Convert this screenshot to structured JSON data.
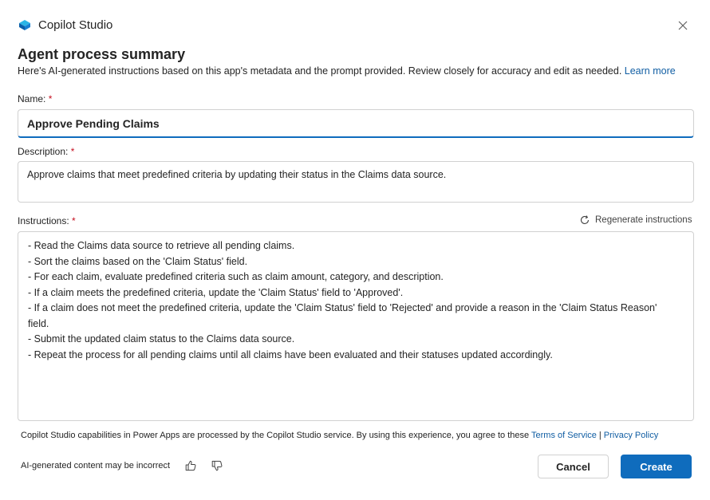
{
  "app": {
    "name": "Copilot Studio"
  },
  "dialog": {
    "title": "Agent process summary",
    "subtitle": "Here's AI-generated instructions based on this app's metadata and the prompt provided. Review closely for accuracy and edit as needed.",
    "learn_more": "Learn more"
  },
  "fields": {
    "name": {
      "label": "Name:",
      "required": "*",
      "value": "Approve Pending Claims"
    },
    "description": {
      "label": "Description:",
      "required": "*",
      "value": "Approve claims that meet predefined criteria by updating their status in the Claims data source."
    },
    "instructions": {
      "label": "Instructions:",
      "required": "*",
      "regenerate_label": "Regenerate instructions",
      "lines": [
        "- Read the Claims data source to retrieve all pending claims.",
        "- Sort the claims based on the 'Claim Status' field.",
        "- For each claim, evaluate predefined criteria such as claim amount, category, and description.",
        "- If a claim meets the predefined criteria, update the 'Claim Status' field to 'Approved'.",
        "- If a claim does not meet the predefined criteria, update the 'Claim Status' field to 'Rejected' and provide a reason in the 'Claim Status Reason'",
        "field.",
        "- Submit the updated claim status to the Claims data source.",
        "- Repeat the process for all pending claims until all claims have been evaluated and their statuses updated accordingly."
      ]
    }
  },
  "footer": {
    "disclaimer": "Copilot Studio capabilities in Power Apps are processed by the Copilot Studio service. By using this experience, you agree to these",
    "terms_link": "Terms of Service",
    "separator": "|",
    "privacy_link": "Privacy Policy",
    "ai_note": "AI-generated content may be incorrect",
    "cancel_label": "Cancel",
    "create_label": "Create"
  },
  "icons": {
    "logo": "copilot-studio-logo",
    "close": "close-icon",
    "regenerate": "refresh-icon",
    "thumbs_up": "thumbs-up-icon",
    "thumbs_down": "thumbs-down-icon"
  },
  "colors": {
    "accent": "#0f6cbd",
    "link": "#115ea3",
    "required": "#c50f1f"
  }
}
